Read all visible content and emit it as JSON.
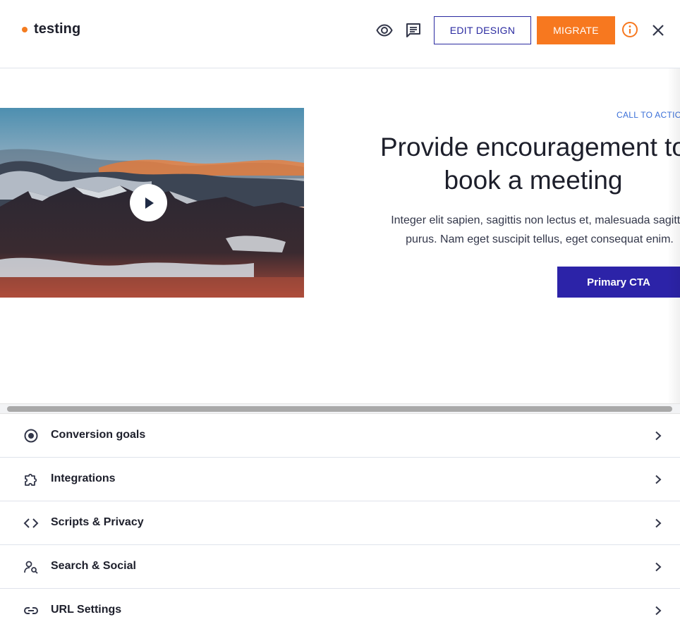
{
  "header": {
    "title": "testing",
    "status_color": "#f47c20",
    "edit_design_label": "EDIT DESIGN",
    "migrate_label": "MIGRATE",
    "icons": [
      "eye-icon",
      "comment-icon",
      "info-icon",
      "close-icon"
    ]
  },
  "preview": {
    "eyebrow": "CALL TO ACTION",
    "headline_line1": "Provide encouragement to",
    "headline_line2": "book a meeting",
    "body_line1": "Integer elit sapien, sagittis non lectus et, malesuada sagittis",
    "body_line2": "purus. Nam eget suscipit tellus, eget consequat enim.",
    "cta_label": "Primary CTA",
    "cta_color": "#2c23a8"
  },
  "settings": {
    "items": [
      {
        "label": "Conversion goals",
        "icon": "target-icon"
      },
      {
        "label": "Integrations",
        "icon": "puzzle-icon"
      },
      {
        "label": "Scripts & Privacy",
        "icon": "code-icon"
      },
      {
        "label": "Search & Social",
        "icon": "user-search-icon"
      },
      {
        "label": "URL Settings",
        "icon": "link-icon"
      }
    ]
  },
  "colors": {
    "accent_orange": "#f7781f",
    "brand_blue": "#2a2aa0"
  }
}
